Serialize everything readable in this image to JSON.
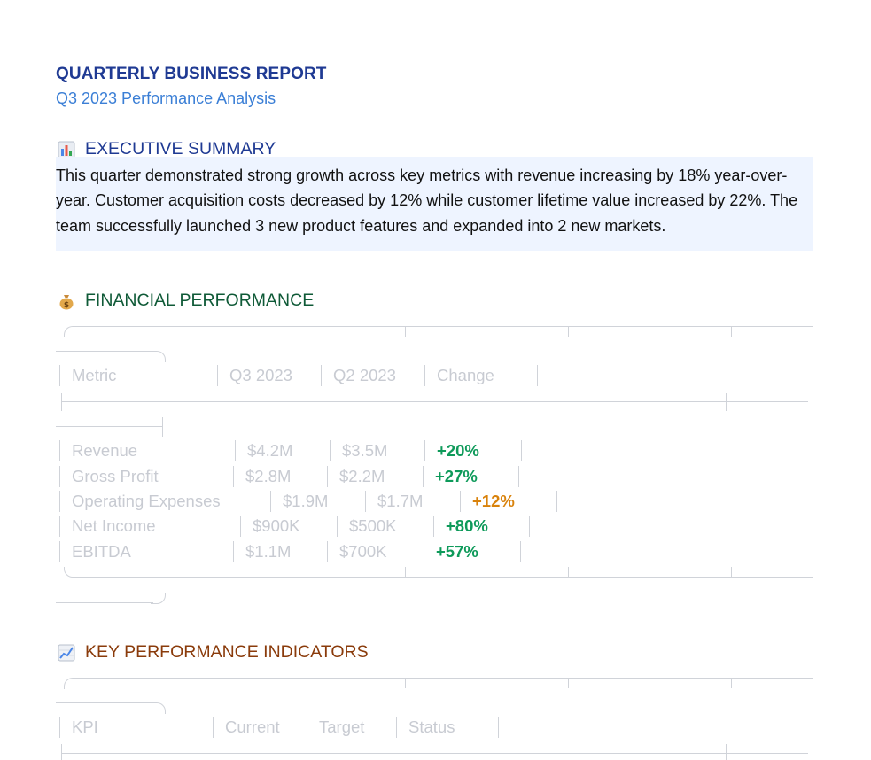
{
  "report": {
    "title": "QUARTERLY BUSINESS REPORT",
    "subtitle": "Q3 2023 Performance Analysis"
  },
  "colors": {
    "title": "#1f3a93",
    "subtitle": "#3b7fd6",
    "exec_heading": "#1f3a93",
    "finance_heading": "#0f5a37",
    "kpi_heading": "#8a3b0b",
    "summary_bg": "#eef4ff",
    "positive": "#0e9a5a",
    "warning": "#d9820b"
  },
  "executive_summary": {
    "icon": "bar-chart-icon",
    "heading": "EXECUTIVE SUMMARY",
    "text": "This quarter demonstrated strong growth across key metrics with revenue increasing by 18% year-over-year. Customer acquisition costs decreased by 12% while customer lifetime value increased by 22%. The team successfully launched 3 new product features and expanded into 2 new markets."
  },
  "financial": {
    "icon": "money-bag-icon",
    "heading": "FINANCIAL PERFORMANCE",
    "headers": [
      "Metric",
      "Q3 2023",
      "Q2 2023",
      "Change"
    ],
    "rows": [
      {
        "metric": "Revenue",
        "q3": "$4.2M",
        "q2": "$3.5M",
        "change": "+20%",
        "status": "positive"
      },
      {
        "metric": "Gross Profit",
        "q3": "$2.8M",
        "q2": "$2.2M",
        "change": "+27%",
        "status": "positive"
      },
      {
        "metric": "Operating Expenses",
        "q3": "$1.9M",
        "q2": "$1.7M",
        "change": "+12%",
        "status": "warning"
      },
      {
        "metric": "Net Income",
        "q3": "$900K",
        "q2": "$500K",
        "change": "+80%",
        "status": "positive"
      },
      {
        "metric": "EBITDA",
        "q3": "$1.1M",
        "q2": "$700K",
        "change": "+57%",
        "status": "positive"
      }
    ]
  },
  "kpi": {
    "icon": "trend-chart-icon",
    "heading": "KEY PERFORMANCE INDICATORS",
    "headers": [
      "KPI",
      "Current",
      "Target",
      "Status"
    ]
  }
}
